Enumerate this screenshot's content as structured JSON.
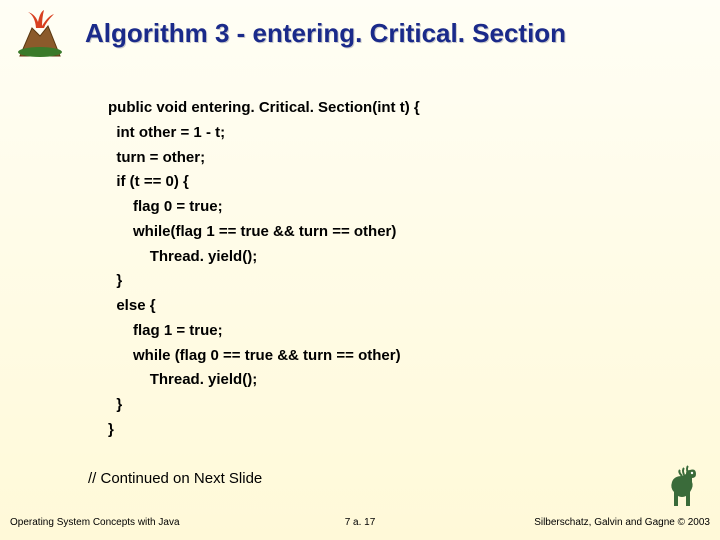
{
  "title": "Algorithm 3 - entering. Critical. Section",
  "code": {
    "l1": "public void entering. Critical. Section(int t) {",
    "l2": "int other = 1 - t;",
    "l3": "turn = other;",
    "l4": "if (t == 0) {",
    "l5": "flag 0 = true;",
    "l6": "while(flag 1 == true && turn == other)",
    "l7": "Thread. yield();",
    "l8": "}",
    "l9": "else {",
    "l10": "flag 1 = true;",
    "l11": "while (flag 0 == true && turn == other)",
    "l12": "Thread. yield();",
    "l13": "}",
    "l14": "}"
  },
  "continued": "// Continued on Next Slide",
  "footer": {
    "left": "Operating System Concepts with Java",
    "center": "7 a. 17",
    "right": "Silberschatz, Galvin and Gagne © 2003"
  },
  "icons": {
    "volcano": "volcano-icon",
    "dino": "dinosaur-icon"
  }
}
